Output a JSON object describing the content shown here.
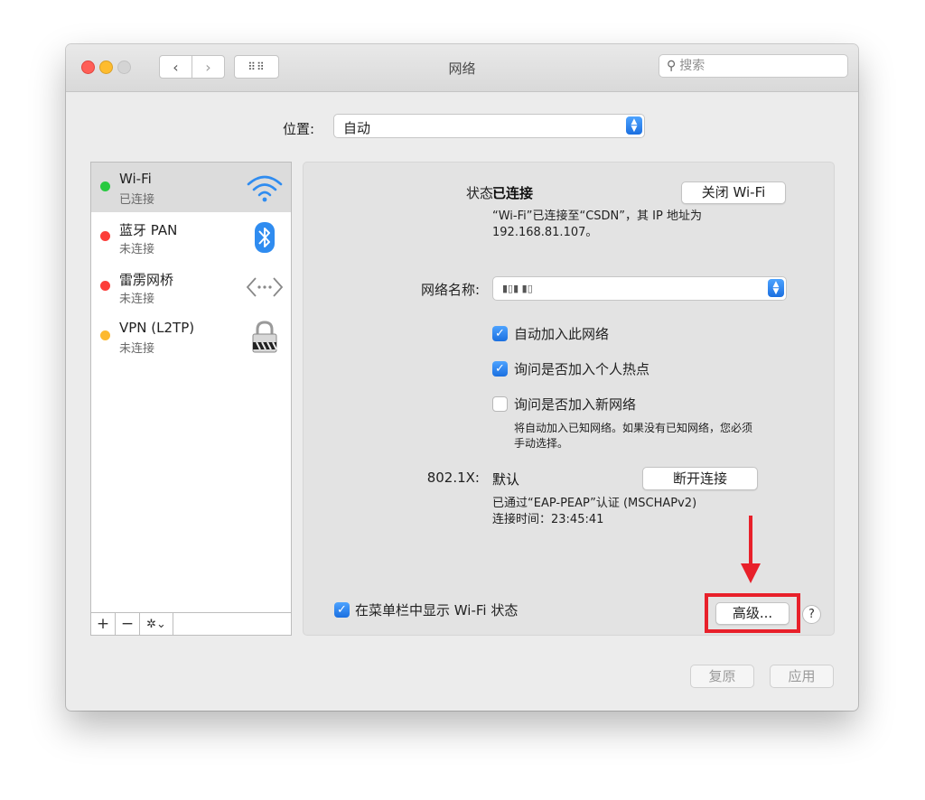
{
  "window": {
    "title": "网络"
  },
  "toolbar": {
    "back_glyph": "‹",
    "forward_glyph": "›",
    "grid_glyph": "⠿⠿",
    "search_placeholder": "搜索"
  },
  "location": {
    "label": "位置:",
    "value": "自动"
  },
  "services": [
    {
      "name": "Wi-Fi",
      "status": "已连接",
      "dot_color": "#28c940",
      "icon": "wifi-icon"
    },
    {
      "name": "蓝牙 PAN",
      "status": "未连接",
      "dot_color": "#fc3d39",
      "icon": "bluetooth-icon"
    },
    {
      "name": "雷雳网桥",
      "status": "未连接",
      "dot_color": "#fc3d39",
      "icon": "thunderbolt-bridge-icon"
    },
    {
      "name": "VPN (L2TP)",
      "status": "未连接",
      "dot_color": "#fdb92f",
      "icon": "lock-icon"
    }
  ],
  "sidebar_buttons": {
    "add": "+",
    "remove": "−",
    "gear": "✲⌄"
  },
  "detail": {
    "status_label": "状态:",
    "status_value": "已连接",
    "turn_off_button": "关闭 Wi-Fi",
    "status_desc_line1": "“Wi-Fi”已连接至“CSDN”，其 IP 地址为",
    "status_desc_line2": "192.168.81.107。",
    "network_name_label": "网络名称:",
    "network_name_value": "▮▯▮ ▮▯",
    "auto_join_label": "自动加入此网络",
    "ask_hotspot_label": "询问是否加入个人热点",
    "ask_new_label": "询问是否加入新网络",
    "ask_new_desc_line1": "将自动加入已知网络。如果没有已知网络，您必须",
    "ask_new_desc_line2": "手动选择。",
    "dot1x_label": "802.1X:",
    "dot1x_value": "默认",
    "disconnect_button": "断开连接",
    "dot1x_desc_line1": "已通过“EAP-PEAP”认证 (MSCHAPv2)",
    "dot1x_desc_line2": "连接时间：23:45:41",
    "show_menubar_label": "在菜单栏中显示 Wi-Fi 状态",
    "advanced_button": "高级...",
    "help_glyph": "?"
  },
  "footer": {
    "revert": "复原",
    "apply": "应用"
  },
  "checkmark": "✓",
  "colors": {
    "accent": "#1b6fe0",
    "annotation": "#e8202a"
  }
}
